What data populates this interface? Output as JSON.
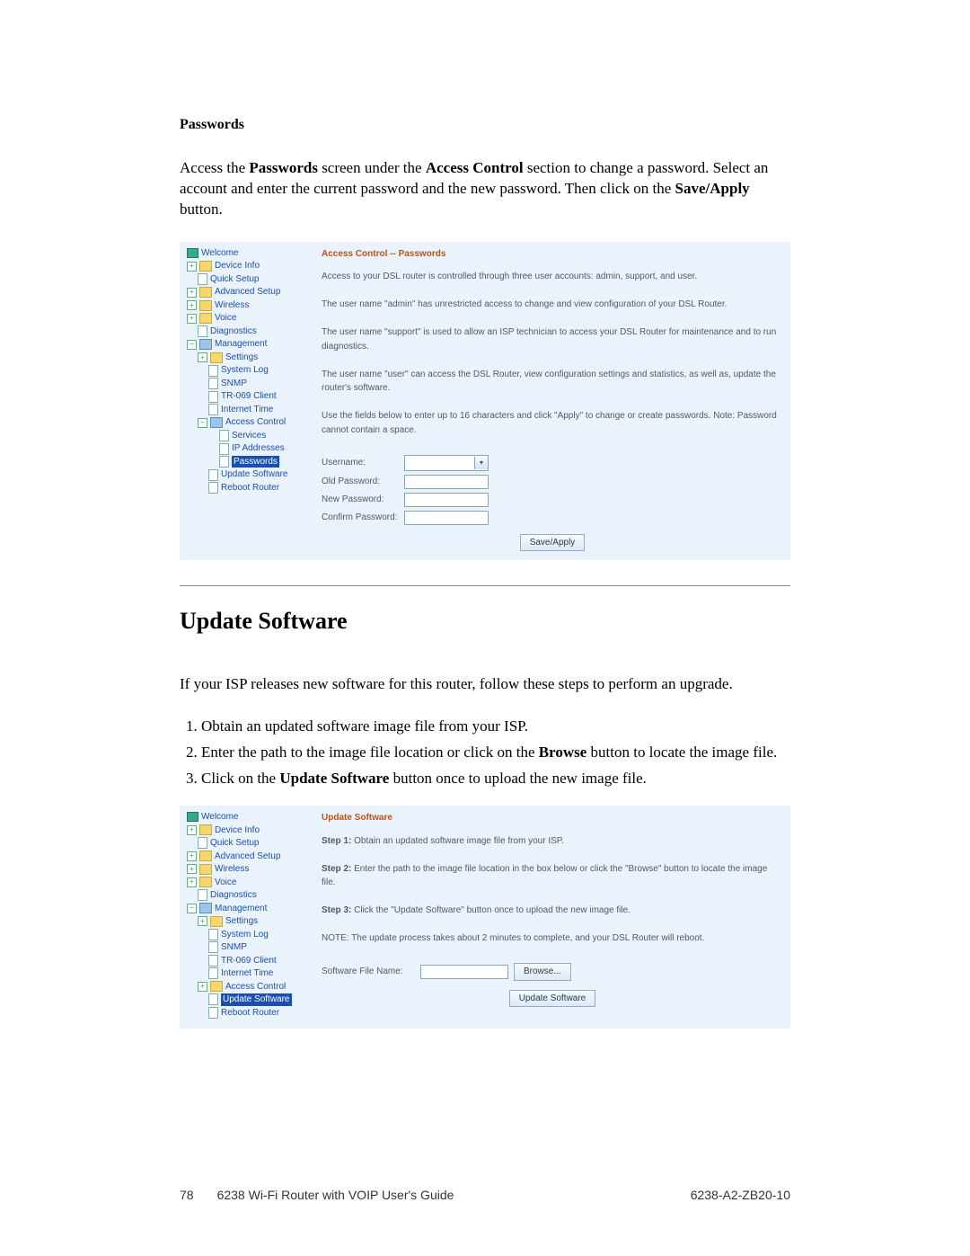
{
  "section1": {
    "title": "Passwords",
    "para_parts": [
      "Access the ",
      "Passwords",
      " screen under the ",
      "Access Control",
      " section to change a password. Select an account and enter the current password and the new password. Then click on the ",
      "Save/Apply",
      " button."
    ]
  },
  "shot1": {
    "tree": {
      "welcome": "Welcome",
      "device_info": "Device Info",
      "quick_setup": "Quick Setup",
      "adv_setup": "Advanced Setup",
      "wireless": "Wireless",
      "voice": "Voice",
      "diagnostics": "Diagnostics",
      "management": "Management",
      "settings": "Settings",
      "system_log": "System Log",
      "snmp": "SNMP",
      "tr069": "TR-069 Client",
      "internet_time": "Internet Time",
      "access_control": "Access Control",
      "services": "Services",
      "ip_addresses": "IP Addresses",
      "passwords": "Passwords",
      "update_software": "Update Software",
      "reboot_router": "Reboot Router"
    },
    "main": {
      "header": "Access Control -- Passwords",
      "p1": "Access to your DSL router is controlled through three  user accounts: admin, support, and user.",
      "p2": "The user name \"admin\" has unrestricted access to change and view configuration of your DSL Router.",
      "p3": "The user name \"support\" is used to allow an ISP technician to access your DSL Router for maintenance and to run diagnostics.",
      "p4": "The user name \"user\" can access the DSL Router, view configuration settings and statistics, as well as, update the router's software.",
      "p5": "Use the fields below to enter up to 16 characters and click \"Apply\" to change or create passwords. Note: Password cannot contain a space.",
      "labels": {
        "username": "Username:",
        "old": "Old Password:",
        "new": "New Password:",
        "confirm": "Confirm Password:"
      },
      "btn": "Save/Apply"
    }
  },
  "section2": {
    "title": "Update Software",
    "intro": "If your ISP releases new software for this router, follow these steps to perform an upgrade.",
    "steps": [
      [
        "Obtain an updated software image file from your ISP."
      ],
      [
        "Enter the path to the image file location or click on the ",
        "Browse",
        " button to locate the image file."
      ],
      [
        "Click on the ",
        "Update Software",
        " button once to upload the new  image file."
      ]
    ]
  },
  "shot2": {
    "tree": {
      "welcome": "Welcome",
      "device_info": "Device Info",
      "quick_setup": "Quick Setup",
      "adv_setup": "Advanced Setup",
      "wireless": "Wireless",
      "voice": "Voice",
      "diagnostics": "Diagnostics",
      "management": "Management",
      "settings": "Settings",
      "system_log": "System Log",
      "snmp": "SNMP",
      "tr069": "TR-069 Client",
      "internet_time": "Internet Time",
      "access_control": "Access Control",
      "update_software": "Update Software",
      "reboot_router": "Reboot Router"
    },
    "main": {
      "header": "Update Software",
      "s1a": "Step 1:",
      "s1b": " Obtain an updated software image file from your ISP.",
      "s2a": "Step 2:",
      "s2b": " Enter the path to the image file location in the box below or click the \"Browse\" button to locate the image file.",
      "s3a": "Step 3:",
      "s3b": " Click the \"Update Software\" button once to upload the new image file.",
      "note": "NOTE: The update process takes about 2 minutes to complete, and your DSL Router will reboot.",
      "file_label": "Software File Name:",
      "browse": "Browse...",
      "update": "Update Software"
    }
  },
  "footer": {
    "page": "78",
    "guide": "6238 Wi-Fi Router with VOIP User's Guide",
    "doc": "6238-A2-ZB20-10"
  }
}
